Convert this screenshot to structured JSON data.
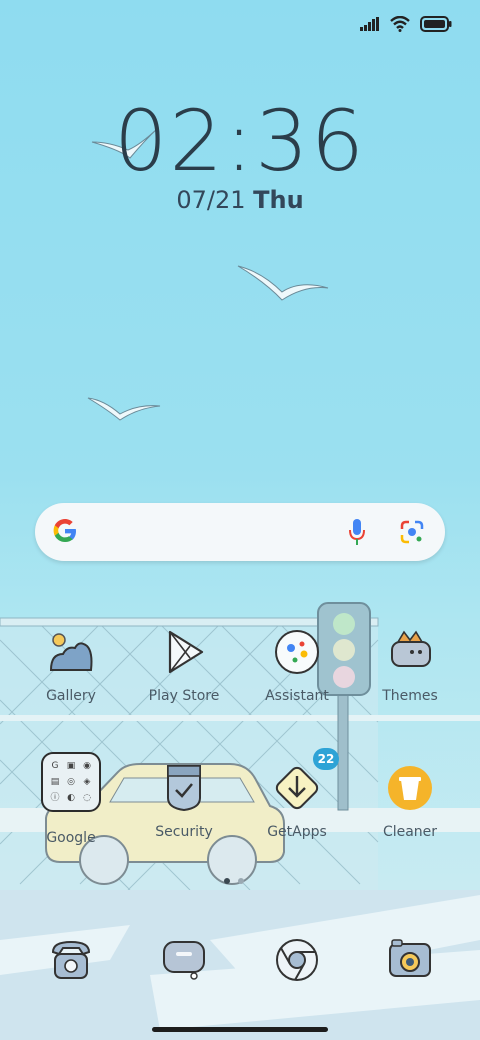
{
  "lockscreen": {
    "time": "02:36",
    "date": "07/21",
    "weekday": "Thu"
  },
  "status_bar": {
    "icons": [
      "signal-icon",
      "wifi-icon",
      "battery-icon"
    ]
  },
  "search_bar": {
    "icons": [
      "google-logo-icon",
      "microphone-icon",
      "google-lens-icon"
    ]
  },
  "apps": {
    "row1": [
      {
        "label": "Gallery",
        "icon": "gallery-icon"
      },
      {
        "label": "Play Store",
        "icon": "play-store-icon"
      },
      {
        "label": "Assistant",
        "icon": "assistant-icon"
      },
      {
        "label": "Themes",
        "icon": "themes-icon"
      }
    ],
    "row2": [
      {
        "label": "Google",
        "icon": "folder-icon"
      },
      {
        "label": "Security",
        "icon": "security-icon"
      },
      {
        "label": "GetApps",
        "icon": "getapps-icon",
        "badge": "22"
      },
      {
        "label": "Cleaner",
        "icon": "cleaner-icon"
      }
    ]
  },
  "page_indicator": {
    "pages": 2,
    "current": 1
  },
  "dock": {
    "icons": [
      "phone-icon",
      "messages-icon",
      "chrome-icon",
      "camera-icon"
    ]
  },
  "colors": {
    "accent_badge": "#2ea3d6",
    "text": "#2b3d4a"
  }
}
